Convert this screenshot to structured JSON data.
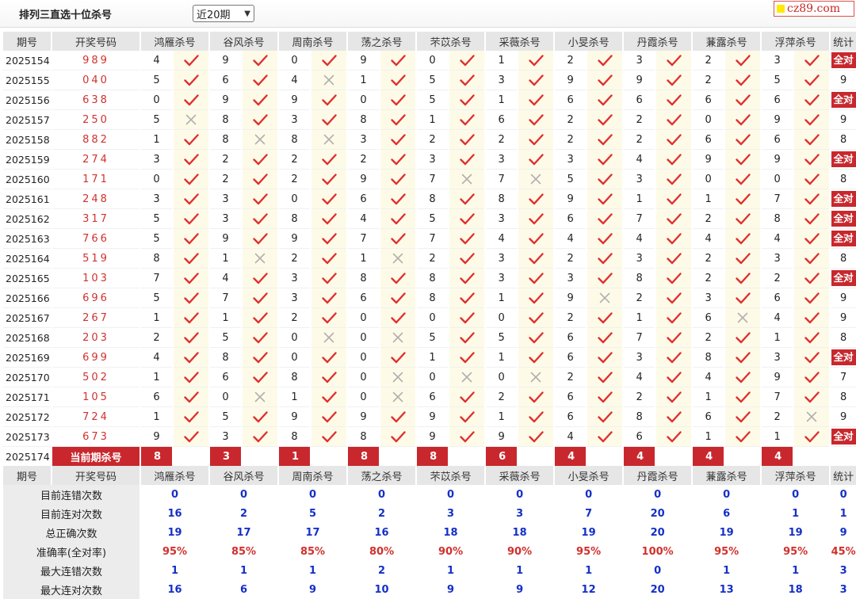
{
  "header": {
    "title": "排列三直选十位杀号",
    "select_value": "近20期",
    "brand": "cz89.com"
  },
  "columns": {
    "period": "期号",
    "draw": "开奖号码",
    "experts": [
      "鸿雁杀号",
      "谷风杀号",
      "周南杀号",
      "荡之杀号",
      "芣苡杀号",
      "采薇杀号",
      "小旻杀号",
      "丹霞杀号",
      "蒹露杀号",
      "浮萍杀号"
    ],
    "stat": "统计"
  },
  "all_correct_label": "全对",
  "rows": [
    {
      "period": "2025154",
      "draw": "989",
      "kills": [
        4,
        9,
        0,
        9,
        0,
        1,
        2,
        3,
        2,
        3
      ],
      "marks": [
        1,
        1,
        1,
        1,
        1,
        1,
        1,
        1,
        1,
        1
      ],
      "stat": "全对"
    },
    {
      "period": "2025155",
      "draw": "040",
      "kills": [
        5,
        6,
        4,
        1,
        5,
        3,
        9,
        9,
        2,
        5
      ],
      "marks": [
        1,
        1,
        0,
        1,
        1,
        1,
        1,
        1,
        1,
        1
      ],
      "stat": "9"
    },
    {
      "period": "2025156",
      "draw": "638",
      "kills": [
        0,
        9,
        9,
        0,
        5,
        1,
        6,
        6,
        6,
        6
      ],
      "marks": [
        1,
        1,
        1,
        1,
        1,
        1,
        1,
        1,
        1,
        1
      ],
      "stat": "全对"
    },
    {
      "period": "2025157",
      "draw": "250",
      "kills": [
        5,
        8,
        3,
        8,
        1,
        6,
        2,
        2,
        0,
        9
      ],
      "marks": [
        0,
        1,
        1,
        1,
        1,
        1,
        1,
        1,
        1,
        1
      ],
      "stat": "9"
    },
    {
      "period": "2025158",
      "draw": "882",
      "kills": [
        1,
        8,
        8,
        3,
        2,
        2,
        2,
        2,
        6,
        6
      ],
      "marks": [
        1,
        0,
        0,
        1,
        1,
        1,
        1,
        1,
        1,
        1
      ],
      "stat": "8"
    },
    {
      "period": "2025159",
      "draw": "274",
      "kills": [
        3,
        2,
        2,
        2,
        3,
        3,
        3,
        4,
        9,
        9
      ],
      "marks": [
        1,
        1,
        1,
        1,
        1,
        1,
        1,
        1,
        1,
        1
      ],
      "stat": "全对"
    },
    {
      "period": "2025160",
      "draw": "171",
      "kills": [
        0,
        2,
        2,
        9,
        7,
        7,
        5,
        3,
        0,
        0
      ],
      "marks": [
        1,
        1,
        1,
        1,
        0,
        0,
        1,
        1,
        1,
        1
      ],
      "stat": "8"
    },
    {
      "period": "2025161",
      "draw": "248",
      "kills": [
        3,
        3,
        0,
        6,
        8,
        8,
        9,
        1,
        1,
        7
      ],
      "marks": [
        1,
        1,
        1,
        1,
        1,
        1,
        1,
        1,
        1,
        1
      ],
      "stat": "全对"
    },
    {
      "period": "2025162",
      "draw": "317",
      "kills": [
        5,
        3,
        8,
        4,
        5,
        3,
        6,
        7,
        2,
        8
      ],
      "marks": [
        1,
        1,
        1,
        1,
        1,
        1,
        1,
        1,
        1,
        1
      ],
      "stat": "全对"
    },
    {
      "period": "2025163",
      "draw": "766",
      "kills": [
        5,
        9,
        9,
        7,
        7,
        4,
        4,
        4,
        4,
        4
      ],
      "marks": [
        1,
        1,
        1,
        1,
        1,
        1,
        1,
        1,
        1,
        1
      ],
      "stat": "全对"
    },
    {
      "period": "2025164",
      "draw": "519",
      "kills": [
        8,
        1,
        2,
        1,
        2,
        3,
        2,
        3,
        2,
        3
      ],
      "marks": [
        1,
        0,
        1,
        0,
        1,
        1,
        1,
        1,
        1,
        1
      ],
      "stat": "8"
    },
    {
      "period": "2025165",
      "draw": "103",
      "kills": [
        7,
        4,
        3,
        8,
        8,
        3,
        3,
        8,
        2,
        2
      ],
      "marks": [
        1,
        1,
        1,
        1,
        1,
        1,
        1,
        1,
        1,
        1
      ],
      "stat": "全对"
    },
    {
      "period": "2025166",
      "draw": "696",
      "kills": [
        5,
        7,
        3,
        6,
        8,
        1,
        9,
        2,
        3,
        6
      ],
      "marks": [
        1,
        1,
        1,
        1,
        1,
        1,
        0,
        1,
        1,
        1
      ],
      "stat": "9"
    },
    {
      "period": "2025167",
      "draw": "267",
      "kills": [
        1,
        1,
        2,
        0,
        0,
        0,
        2,
        1,
        6,
        4
      ],
      "marks": [
        1,
        1,
        1,
        1,
        1,
        1,
        1,
        1,
        0,
        1
      ],
      "stat": "9"
    },
    {
      "period": "2025168",
      "draw": "203",
      "kills": [
        2,
        5,
        0,
        0,
        5,
        5,
        6,
        7,
        2,
        1
      ],
      "marks": [
        1,
        1,
        0,
        0,
        1,
        1,
        1,
        1,
        1,
        1
      ],
      "stat": "8"
    },
    {
      "period": "2025169",
      "draw": "699",
      "kills": [
        4,
        8,
        0,
        0,
        1,
        1,
        6,
        3,
        8,
        3
      ],
      "marks": [
        1,
        1,
        1,
        1,
        1,
        1,
        1,
        1,
        1,
        1
      ],
      "stat": "全对"
    },
    {
      "period": "2025170",
      "draw": "502",
      "kills": [
        1,
        6,
        8,
        0,
        0,
        0,
        2,
        4,
        4,
        9
      ],
      "marks": [
        1,
        1,
        1,
        0,
        0,
        0,
        1,
        1,
        1,
        1
      ],
      "stat": "7"
    },
    {
      "period": "2025171",
      "draw": "105",
      "kills": [
        6,
        0,
        1,
        0,
        6,
        2,
        6,
        2,
        1,
        7
      ],
      "marks": [
        1,
        0,
        1,
        0,
        1,
        1,
        1,
        1,
        1,
        1
      ],
      "stat": "8"
    },
    {
      "period": "2025172",
      "draw": "724",
      "kills": [
        1,
        5,
        9,
        9,
        9,
        1,
        6,
        8,
        6,
        2
      ],
      "marks": [
        1,
        1,
        1,
        1,
        1,
        1,
        1,
        1,
        1,
        0
      ],
      "stat": "9"
    },
    {
      "period": "2025173",
      "draw": "673",
      "kills": [
        9,
        3,
        8,
        8,
        9,
        9,
        4,
        6,
        1,
        1
      ],
      "marks": [
        1,
        1,
        1,
        1,
        1,
        1,
        1,
        1,
        1,
        1
      ],
      "stat": "全对"
    }
  ],
  "current": {
    "period": "2025174",
    "label": "当前期杀号",
    "kills": [
      "8",
      "3",
      "1",
      "8",
      "8",
      "6",
      "4",
      "4",
      "4",
      "4"
    ]
  },
  "stats": [
    {
      "label": "目前连错次数",
      "values": [
        "0",
        "0",
        "0",
        "0",
        "0",
        "0",
        "0",
        "0",
        "0",
        "0",
        "0"
      ],
      "red": false
    },
    {
      "label": "目前连对次数",
      "values": [
        "16",
        "2",
        "5",
        "2",
        "3",
        "3",
        "7",
        "20",
        "6",
        "1",
        "1"
      ],
      "red": false
    },
    {
      "label": "总正确次数",
      "values": [
        "19",
        "17",
        "17",
        "16",
        "18",
        "18",
        "19",
        "20",
        "19",
        "19",
        "9"
      ],
      "red": false
    },
    {
      "label": "准确率(全对率)",
      "values": [
        "95%",
        "85%",
        "85%",
        "80%",
        "90%",
        "90%",
        "95%",
        "100%",
        "95%",
        "95%",
        "45%"
      ],
      "red": true
    },
    {
      "label": "最大连错次数",
      "values": [
        "1",
        "1",
        "1",
        "2",
        "1",
        "1",
        "1",
        "0",
        "1",
        "1",
        "3"
      ],
      "red": false
    },
    {
      "label": "最大连对次数",
      "values": [
        "16",
        "6",
        "9",
        "10",
        "9",
        "9",
        "12",
        "20",
        "13",
        "18",
        "3"
      ],
      "red": false
    }
  ],
  "colors": {
    "accent_red": "#c8282d",
    "stat_blue": "#1530c8",
    "check_red": "#e03030",
    "cross_gray": "#b0b0b0"
  },
  "icons": {
    "correct": "check-icon",
    "wrong": "cross-icon"
  }
}
